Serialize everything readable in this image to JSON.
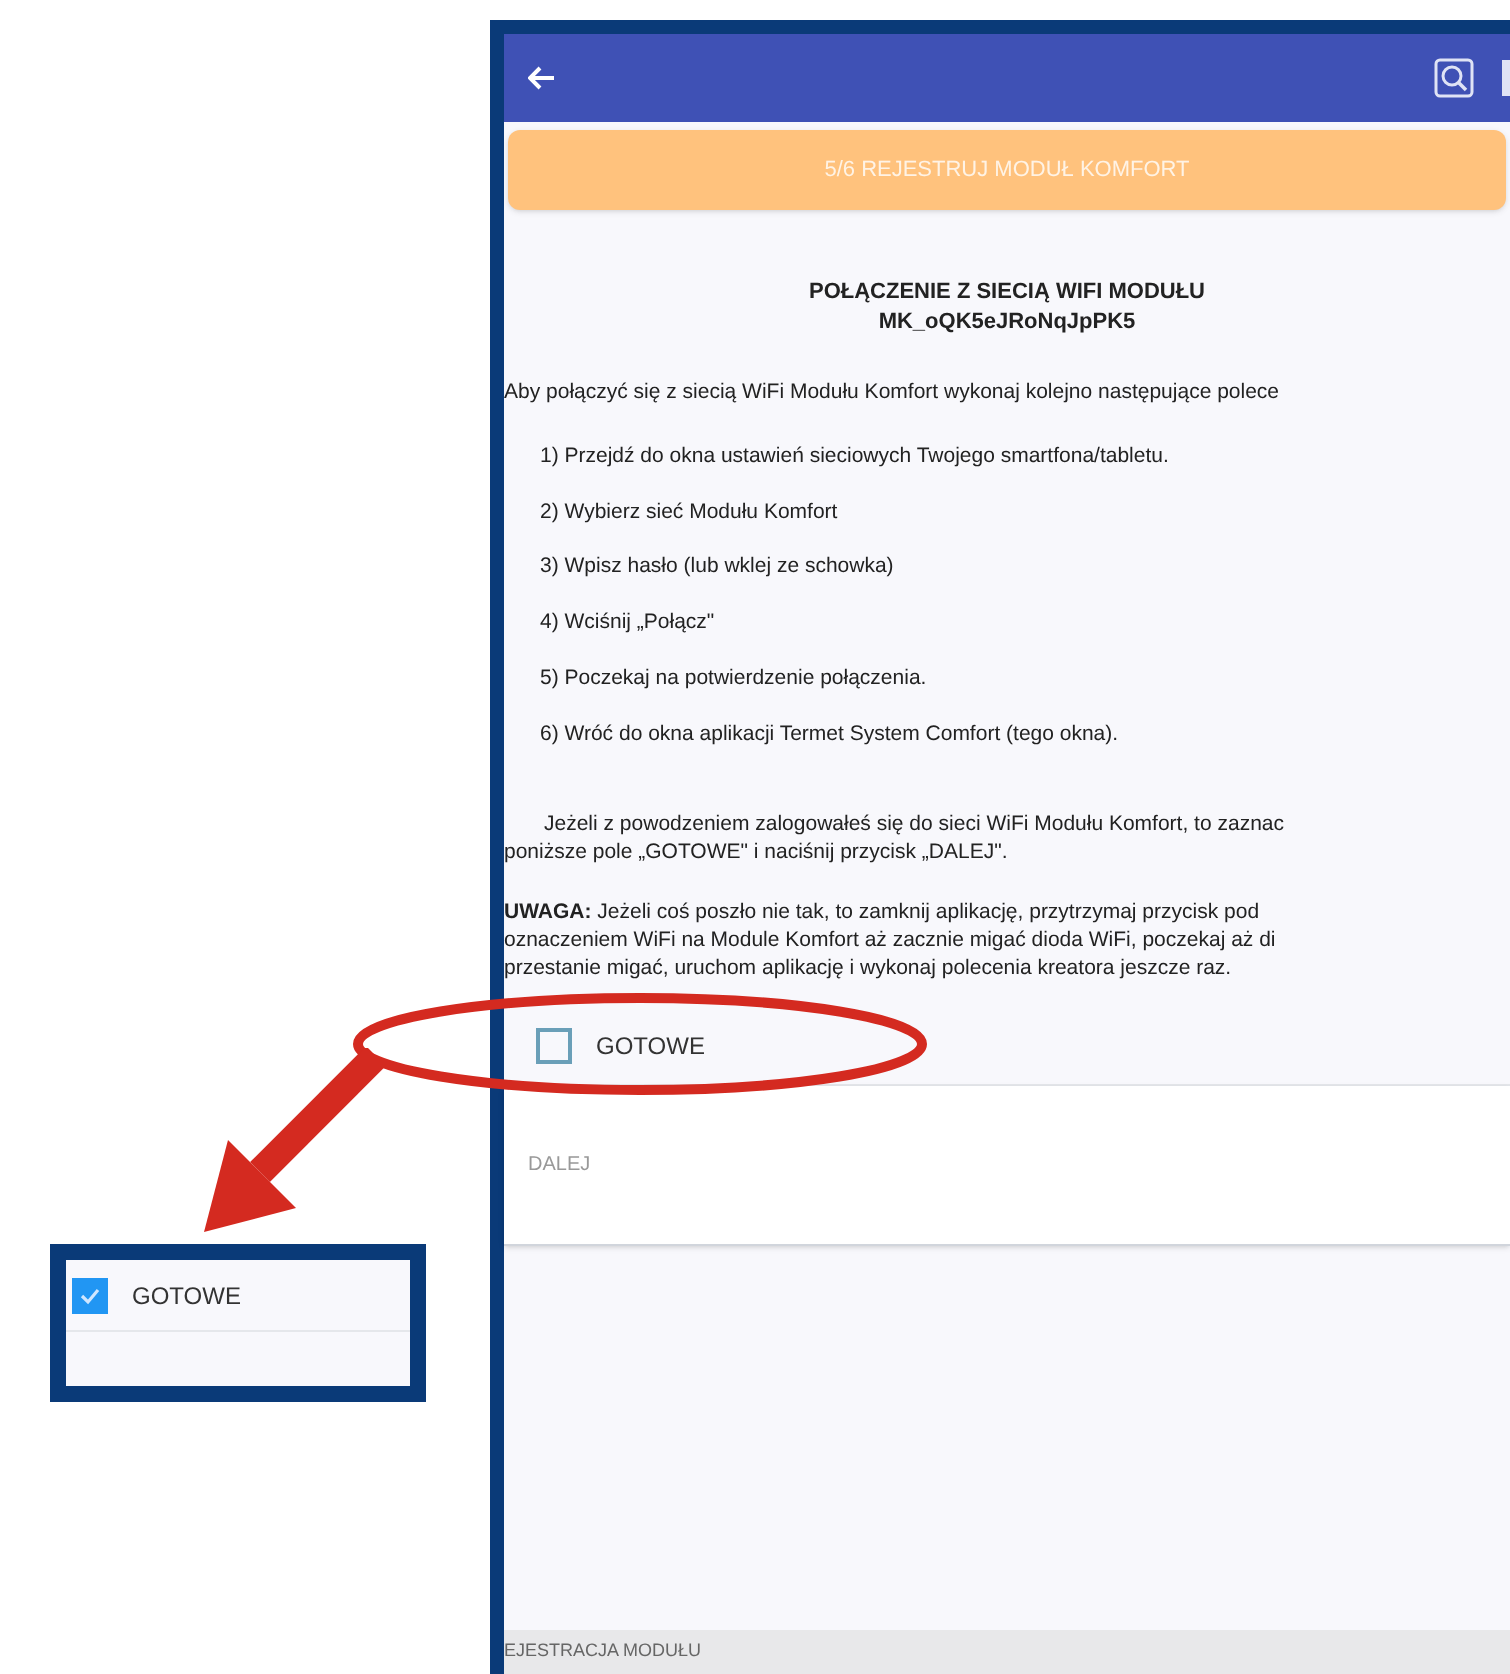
{
  "banner": {
    "text": "5/6 REJESTRUJ MODUŁ KOMFORT"
  },
  "heading": [
    "POŁĄCZENIE Z SIECIĄ WIFI MODUŁU",
    "MK_oQK5eJRoNqJpPK5"
  ],
  "intro": "Aby połączyć się z siecią WiFi Modułu Komfort wykonaj kolejno następujące polece",
  "steps": [
    "1) Przejdź do okna ustawień sieciowych Twojego smartfona/tabletu.",
    "2) Wybierz sieć Modułu Komfort",
    "3) Wpisz hasło (lub wklej ze schowka)",
    "4) Wciśnij „Połącz\"",
    "5) Poczekaj na potwierdzenie połączenia.",
    "6) Wróć do okna aplikacji Termet System Comfort (tego okna)."
  ],
  "info_lines": [
    "Jeżeli z powodzeniem zalogowałeś się do sieci WiFi Modułu Komfort, to zaznac",
    "poniższe pole „GOTOWE\" i naciśnij przycisk „DALEJ\"."
  ],
  "warning_lines": [
    "**UWAGA:** Jeżeli coś poszło nie tak, to zamknij aplikację, przytrzymaj przycisk pod",
    "oznaczeniem WiFi na Module Komfort aż zacznie migać dioda WiFi, poczekaj aż di",
    "przestanie migać, uruchom aplikację i wykonaj polecenia kreatora jeszcze raz."
  ],
  "ready_checkbox": {
    "label": "GOTOWE",
    "checked": false
  },
  "next_row": {
    "label": "DALEJ"
  },
  "footer": "EJESTRACJA MODUŁU",
  "zoom_inset": {
    "label": "GOTOWE",
    "checked": true
  }
}
